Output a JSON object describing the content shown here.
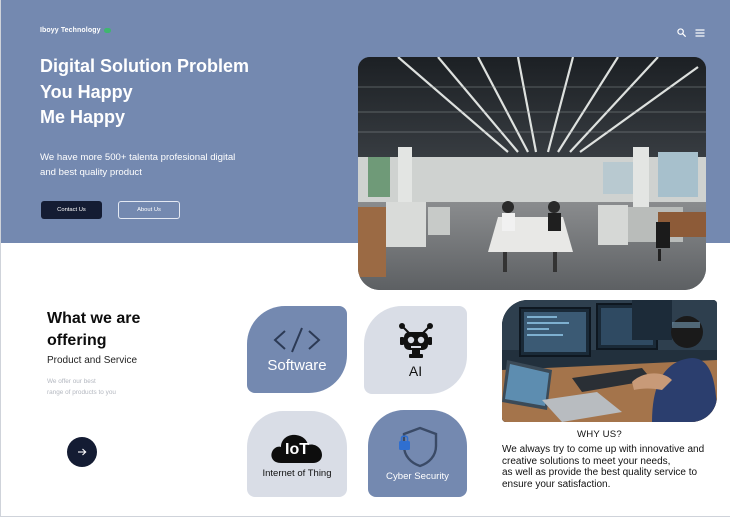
{
  "header": {
    "brand_name": "Iboyy Technology",
    "search_icon": "search-icon",
    "menu_icon": "hamburger-menu-icon"
  },
  "hero": {
    "title_lines": [
      "Digital Solution Problem",
      "You Happy",
      "Me Happy"
    ],
    "subtitle_lines": [
      "We have more 500+ talenta profesional digital",
      "and best quality product"
    ],
    "contact_label": "Contact Us",
    "about_label": "About Us"
  },
  "offering": {
    "title_lines": [
      "What we are",
      "offering"
    ],
    "subtitle": "Product and Service",
    "desc_lines": [
      "We offer our best",
      "range of products  to you"
    ],
    "next_icon": "arrow-right-icon"
  },
  "services": [
    {
      "label": "Software",
      "icon": "code-brackets-icon"
    },
    {
      "label": "AI",
      "icon": "robot-icon"
    },
    {
      "label": "Internet of Thing",
      "icon": "iot-cloud-icon",
      "icon_text": "IoT"
    },
    {
      "label": "Cyber Security",
      "icon": "shield-lock-icon"
    }
  ],
  "why": {
    "title": "WHY US?",
    "lines": [
      "We always try to come up with innovative and",
      "creative solutions to meet your needs,",
      "as well as provide the best quality service to",
      "ensure your satisfaction."
    ]
  },
  "colors": {
    "hero_bg": "#7489b0",
    "dark_navy": "#141c33",
    "card_light": "#d9dde6",
    "brand_badge": "#3fb66f"
  }
}
